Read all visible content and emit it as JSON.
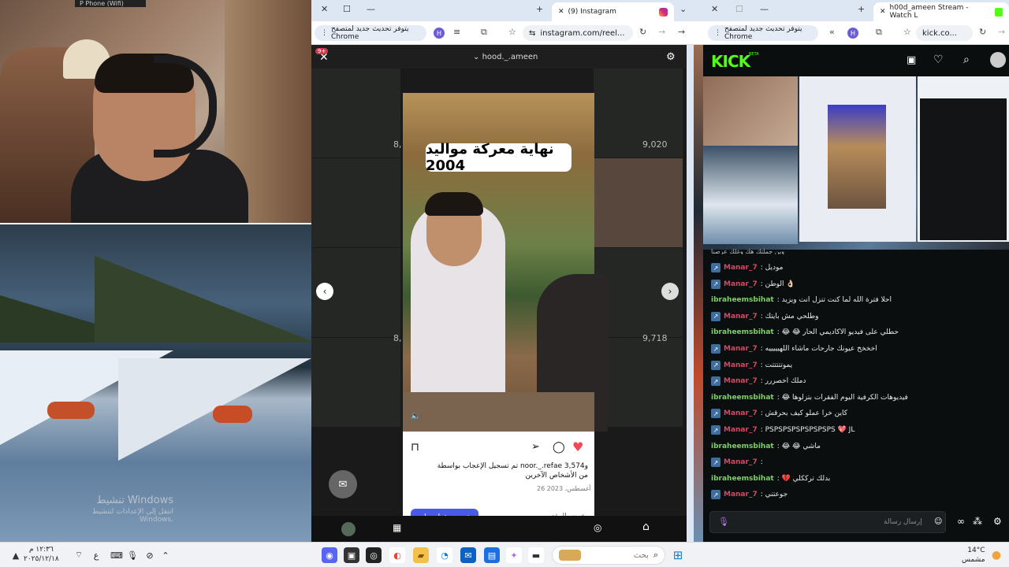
{
  "webcam": {
    "top_tag": "P Phone (Wifi)"
  },
  "desktop": {
    "activate_title": "تنشيط Windows",
    "activate_sub": "انتقل إلى الإعدادات لتنشيط Windows."
  },
  "instagram_window": {
    "tab_title": "(9) Instagram",
    "update_pill": "يتوفر تحديث جديد لمتصفح Chrome",
    "profile_initial": "H",
    "url": "instagram.com/reel...",
    "header_username": "hood._.ameen",
    "notif_count": "9+",
    "grid_counts": [
      "8,",
      "9,020",
      "8,",
      "9,718"
    ],
    "reel_caption": "نهاية معركة مواليد 2004",
    "likes_text": "تم تسجيل الإعجاب بواسطة noor._.refae و3,574",
    "likes_text2": "من الأشخاص الآخرين",
    "date": "26 أغسطس، 2023",
    "boost_button": "ترويج مقطع ريلز",
    "view_insights": "عرض الرؤى"
  },
  "kick_window": {
    "tab_title": "h00d_ameen Stream - Watch L",
    "update_pill": "يتوفر تحديث جديد لمتصفح Chrome",
    "profile_initial": "H",
    "url": "kick.co...",
    "logo": "KICK",
    "logo_beta": "BETA",
    "top_partial": "وين جملتك هك وغلك عرصنا",
    "chat": [
      {
        "user": "Manar_7",
        "text": ": موديل",
        "color": "#d34a63",
        "badge": true
      },
      {
        "user": "Manar_7",
        "text": ": الوطن 👌🏻",
        "color": "#d34a63",
        "badge": true
      },
      {
        "user": "ibraheemsbihat",
        "text": ": احلا فترة الله لما كنت تنزل انت ويزيد",
        "color": "#7fd06a",
        "badge": false
      },
      {
        "user": "Manar_7",
        "text": ": وطلحي مش بايتك",
        "color": "#d34a63",
        "badge": true
      },
      {
        "user": "ibraheemsbihat",
        "text": ": 😂 😂 حطلي على فيديو الاكاديمي الحار",
        "color": "#7fd06a",
        "badge": false
      },
      {
        "user": "Manar_7",
        "text": ": اخخخخ عيونك جارحات ماشاء اللهيييييه",
        "color": "#d34a63",
        "badge": true
      },
      {
        "user": "Manar_7",
        "text": ": يموتتتتتت",
        "color": "#d34a63",
        "badge": true
      },
      {
        "user": "Manar_7",
        "text": ": دملك اخصررر",
        "color": "#d34a63",
        "badge": true
      },
      {
        "user": "ibraheemsbihat",
        "text": ": 😂 فيديوهات الكرفية اليوم الفقرات بتزلوها",
        "color": "#7fd06a",
        "badge": false
      },
      {
        "user": "Manar_7",
        "text": ": كاين خرا عملو كيف بحرقش",
        "color": "#d34a63",
        "badge": true
      },
      {
        "user": "Manar_7",
        "text": ": PSPSPSPSPSPSPSPS 💖 JL",
        "color": "#d34a63",
        "badge": true
      },
      {
        "user": "ibraheemsbihat",
        "text": ": 😂 😂 ماشي",
        "color": "#7fd06a",
        "badge": false
      },
      {
        "user": "Manar_7",
        "text": ":",
        "color": "#d34a63",
        "badge": true
      },
      {
        "user": "ibraheemsbihat",
        "text": ": 💔 بدلك ترككلي",
        "color": "#7fd06a",
        "badge": false
      },
      {
        "user": "Manar_7",
        "text": ": جوعتني",
        "color": "#d34a63",
        "badge": true
      }
    ],
    "chat_placeholder": "إرسال رسالة"
  },
  "taskbar": {
    "time": "١٢:٣٦ م",
    "date": "٢٠٢٥/١٢/١٨",
    "lang": "ع",
    "search_placeholder": "بحث",
    "weather_temp": "14°C",
    "weather_desc": "مشمس"
  }
}
